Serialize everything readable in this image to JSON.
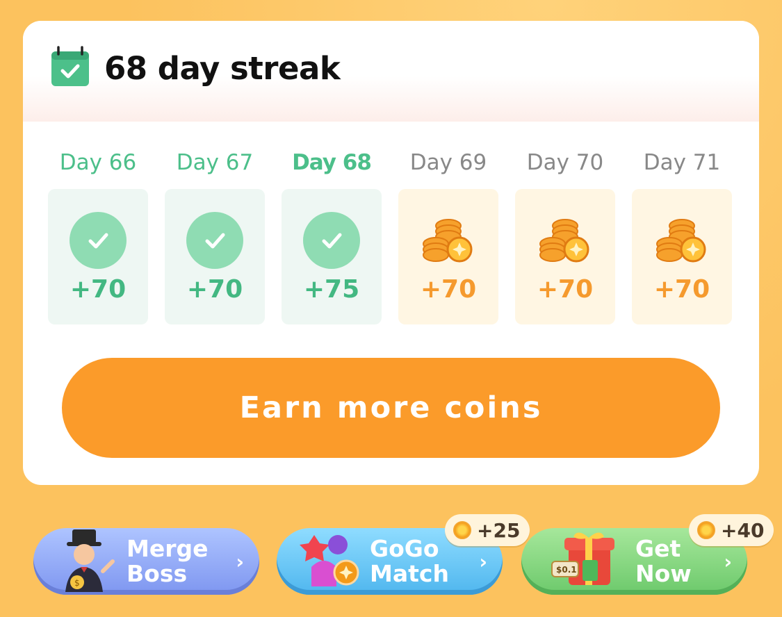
{
  "streak": {
    "title": "68 day streak"
  },
  "days": [
    {
      "label": "Day 66",
      "reward": "+70",
      "state": "done"
    },
    {
      "label": "Day 67",
      "reward": "+70",
      "state": "done"
    },
    {
      "label": "Day 68",
      "reward": "+75",
      "state": "today"
    },
    {
      "label": "Day 69",
      "reward": "+70",
      "state": "pending"
    },
    {
      "label": "Day 70",
      "reward": "+70",
      "state": "pending"
    },
    {
      "label": "Day 71",
      "reward": "+70",
      "state": "pending"
    }
  ],
  "earn_button": {
    "label": "Earn more coins"
  },
  "promos": [
    {
      "title": "Merge Boss",
      "icon": "merge-boss-character-icon"
    },
    {
      "title": "GoGo Match",
      "icon": "gogo-match-gems-icon",
      "bonus": "+25"
    },
    {
      "title": "Get Now",
      "icon": "gift-box-icon",
      "bonus": "+40",
      "price_tag": "$0.1"
    }
  ],
  "colors": {
    "background": "#fcc25e",
    "done_green": "#4cbf8a",
    "pending_orange": "#f59a2e",
    "button_orange": "#fb9b2a"
  }
}
